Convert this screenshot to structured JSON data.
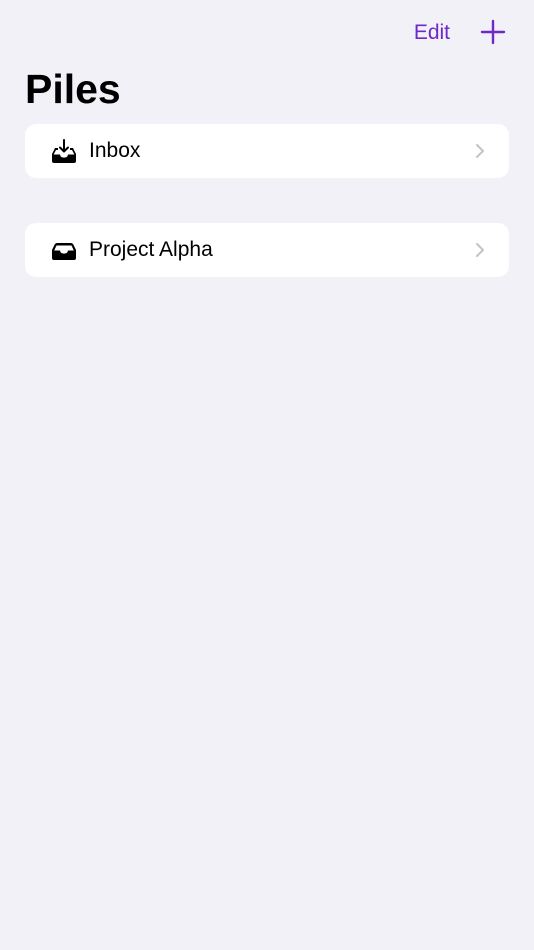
{
  "nav": {
    "edit_label": "Edit",
    "add_icon": "plus-icon",
    "accent_color": "#6e2ac8"
  },
  "title": "Piles",
  "piles": [
    {
      "label": "Inbox",
      "icon": "tray-download-icon"
    },
    {
      "label": "Project Alpha",
      "icon": "tray-icon"
    }
  ],
  "colors": {
    "background": "#f2f1f7",
    "row_background": "#ffffff",
    "chevron": "#c4c4c7"
  }
}
